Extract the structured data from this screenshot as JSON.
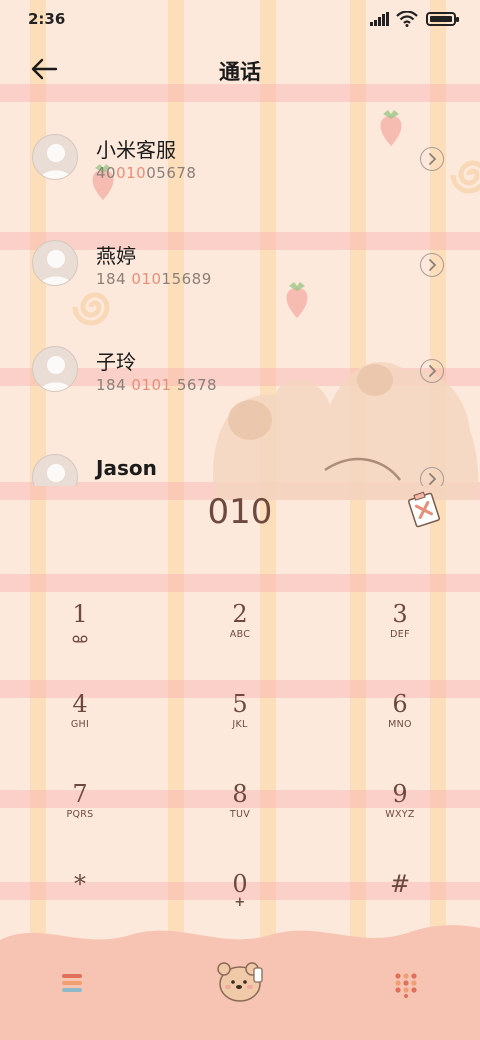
{
  "status": {
    "time": "2:36"
  },
  "header": {
    "title": "通话"
  },
  "contacts": [
    {
      "name": "小米客服",
      "number_pre": "40",
      "number_hl": "010",
      "number_post": "05678"
    },
    {
      "name": "燕婷",
      "number_pre": "184 ",
      "number_hl": "010",
      "number_post": "15689"
    },
    {
      "name": "子玲",
      "number_pre": "184 ",
      "number_hl": "0101",
      "number_post": " 5678"
    },
    {
      "name": "Jason",
      "number_pre": "",
      "number_hl": "",
      "number_post": ""
    }
  ],
  "dial": {
    "value": "010"
  },
  "keypad": [
    {
      "digit": "1",
      "letters": ""
    },
    {
      "digit": "2",
      "letters": "ABC"
    },
    {
      "digit": "3",
      "letters": "DEF"
    },
    {
      "digit": "4",
      "letters": "GHI"
    },
    {
      "digit": "5",
      "letters": "JKL"
    },
    {
      "digit": "6",
      "letters": "MNO"
    },
    {
      "digit": "7",
      "letters": "PQRS"
    },
    {
      "digit": "8",
      "letters": "TUV"
    },
    {
      "digit": "9",
      "letters": "WXYZ"
    },
    {
      "digit": "*",
      "letters": ""
    },
    {
      "digit": "0",
      "letters": "+"
    },
    {
      "digit": "#",
      "letters": ""
    }
  ],
  "icons": {
    "back": "arrow-left-icon",
    "detail": "chevron-right-icon",
    "voicemail": "voicemail-icon",
    "note": "sticky-note-icon",
    "menu": "menu-icon",
    "call": "bear-call-icon",
    "dialpad": "dialpad-icon"
  },
  "colors": {
    "accent": "#e88f78",
    "digit": "#6e4a3e",
    "background": "#fde9db",
    "bottom_bar": "#f7c4b3"
  }
}
